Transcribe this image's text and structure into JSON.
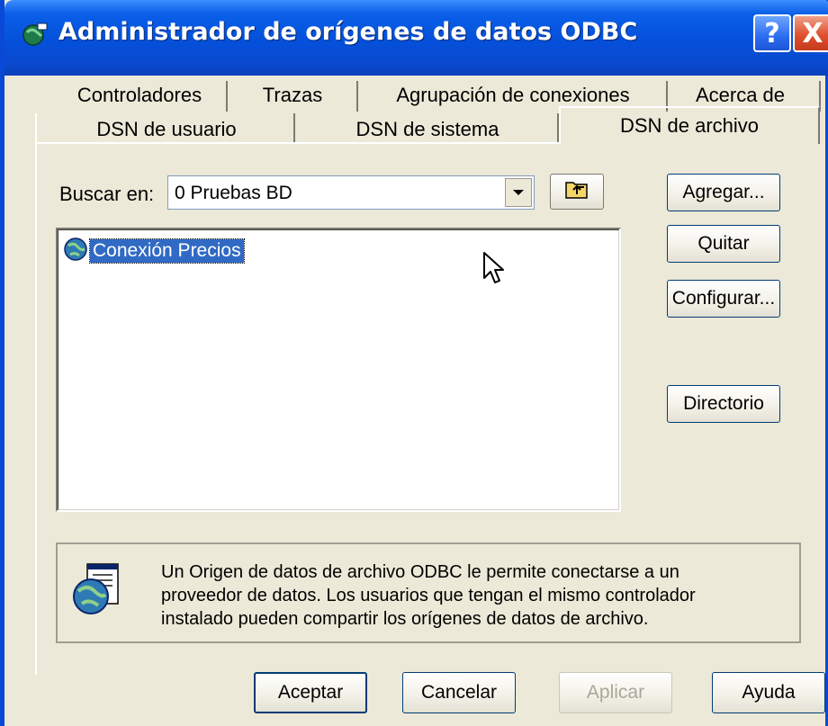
{
  "window": {
    "title": "Administrador de orígenes de datos ODBC",
    "help_glyph": "?",
    "close_glyph": "X"
  },
  "tabs": {
    "row_back": [
      "Controladores",
      "Trazas",
      "Agrupación de conexiones",
      "Acerca de"
    ],
    "row_front": [
      "DSN de usuario",
      "DSN de sistema",
      "DSN de archivo"
    ],
    "active": "DSN de archivo"
  },
  "lookin": {
    "label": "Buscar en:",
    "value": "0 Pruebas BD"
  },
  "files": [
    {
      "label": "Conexión Precios",
      "icon": "globe-dsn-icon",
      "selected": true
    }
  ],
  "side_buttons": {
    "add": "Agregar...",
    "remove": "Quitar",
    "configure": "Configurar...",
    "directory": "Directorio"
  },
  "info": {
    "line1": "Un Origen de datos de archivo ODBC le permite conectarse a un",
    "line2": "proveedor de datos. Los usuarios que tengan el mismo controlador",
    "line3": "instalado pueden compartir los orígenes de datos de archivo.",
    "icon": "file-dsn-icon"
  },
  "footer": {
    "ok": "Aceptar",
    "cancel": "Cancelar",
    "apply": "Aplicar",
    "help": "Ayuda"
  },
  "colors": {
    "titlebar": "#0550DA",
    "face": "#ECE9D8",
    "selection": "#316AC5"
  }
}
